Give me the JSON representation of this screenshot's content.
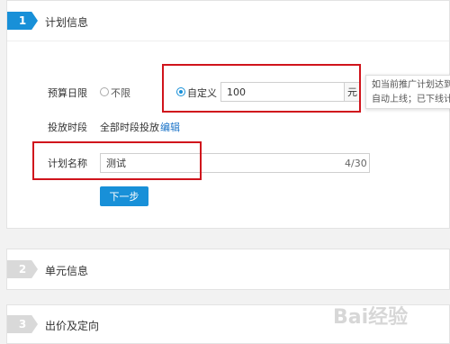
{
  "steps": [
    {
      "num": "1",
      "title": "计划信息"
    },
    {
      "num": "2",
      "title": "单元信息"
    },
    {
      "num": "3",
      "title": "出价及定向"
    }
  ],
  "budget": {
    "label": "预算日限",
    "option_unlimited": "不限",
    "option_custom": "自定义",
    "value": "100",
    "unit": "元"
  },
  "tooltip": {
    "line1": "如当前推广计划达到",
    "line2": "自动上线；已下线计"
  },
  "schedule": {
    "label": "投放时段",
    "value": "全部时段投放",
    "edit_link": "编辑"
  },
  "plan_name": {
    "label": "计划名称",
    "value": "测试",
    "counter": "4/30"
  },
  "next_button": "下一步",
  "watermark": "Bai经验",
  "colors": {
    "accent": "#1890d8",
    "highlight": "#d0141c"
  }
}
